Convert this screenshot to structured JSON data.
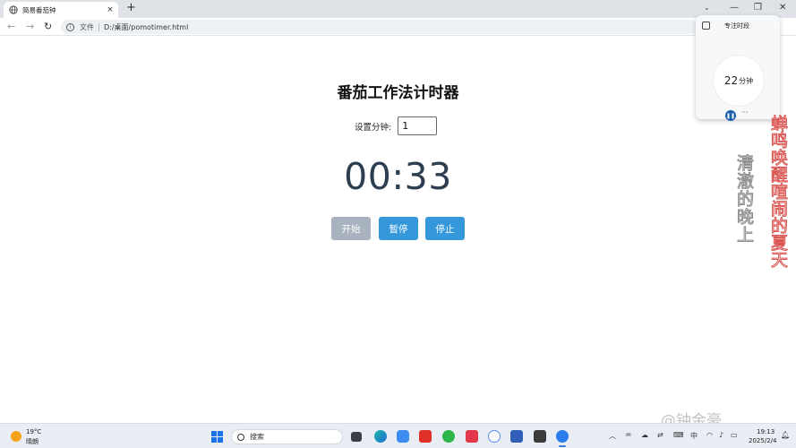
{
  "browser": {
    "tab_title": "简易番茄钟",
    "tab_close": "×",
    "new_tab": "+",
    "scheme_label": "文件",
    "url": "D:/桌面/pomotimer.html",
    "nav_back": "←",
    "nav_forward": "→",
    "nav_reload": "↻",
    "dropdown": "⌄",
    "minimize": "—",
    "maximize": "❐",
    "close": "✕"
  },
  "page": {
    "title": "番茄工作法计时器",
    "setting_label": "设置分钟:",
    "minutes_value": "1",
    "timer_display": "00:33",
    "buttons": {
      "start": "开始",
      "pause": "暂停",
      "stop": "停止"
    },
    "button_colors": {
      "start_disabled": "#a9b3bf",
      "primary": "#3498db"
    }
  },
  "focus_widget": {
    "title": "专注时段",
    "minutes": "22",
    "unit": "分钟",
    "more": "···"
  },
  "decoration": {
    "vertical_text_1": "清澈的晚上",
    "vertical_text_2": "蝉鸣唤醒喧闹的夏天"
  },
  "watermark": "@钟金豪",
  "taskbar": {
    "weather_temp": "19°C",
    "weather_desc": "晴朗",
    "search_placeholder": "搜索",
    "ime": "中",
    "time": "19:13",
    "date": "2025/2/4"
  },
  "icons": {
    "tab": "globe-icon",
    "search": "search-icon",
    "start": "windows-start-icon",
    "weather": "sun-icon"
  }
}
